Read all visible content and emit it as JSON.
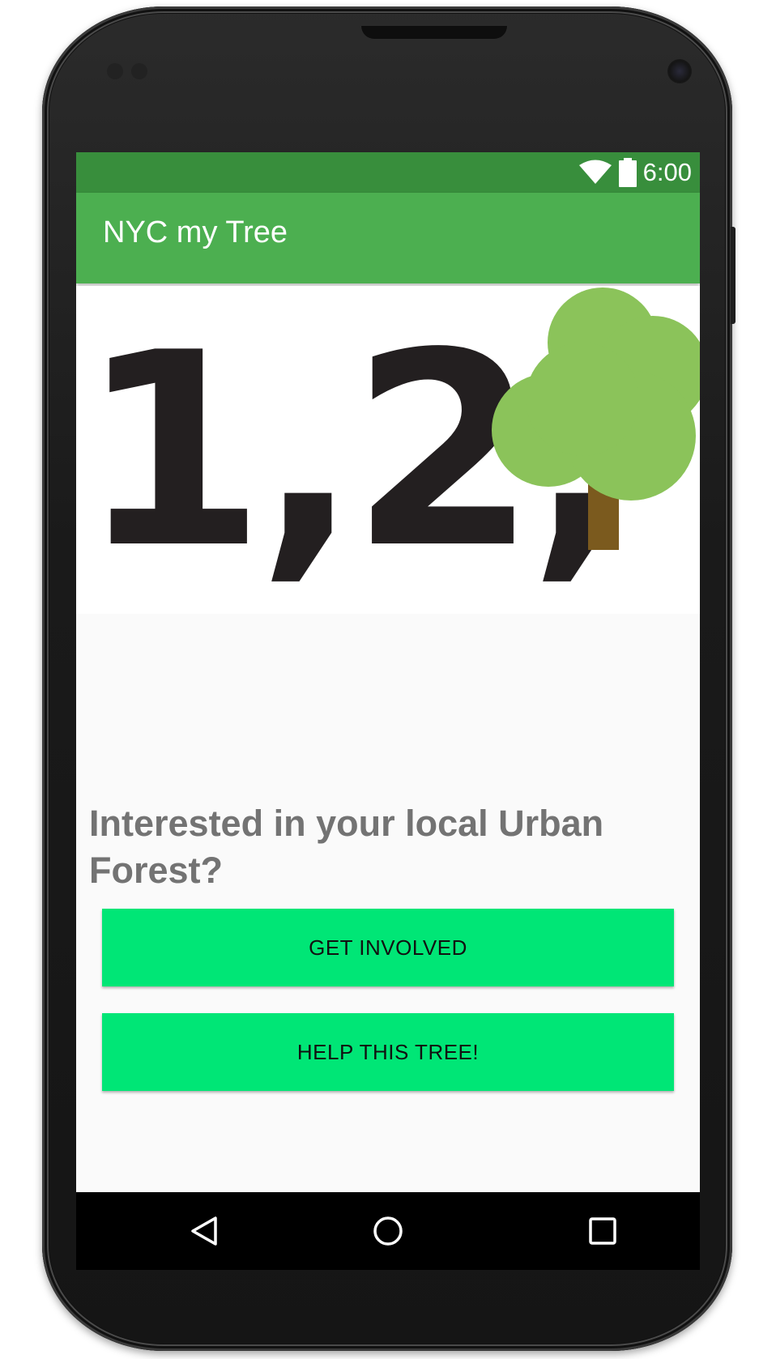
{
  "status_bar": {
    "time": "6:00",
    "icons": [
      "wifi-icon",
      "battery-icon"
    ]
  },
  "app_bar": {
    "title": "NYC my Tree"
  },
  "banner": {
    "text": "1,2,",
    "icon": "tree-icon",
    "colors": {
      "foliage": "#8bc35a",
      "trunk": "#7b5a1e",
      "digits": "#231f20"
    }
  },
  "main": {
    "headline": "Interested in your local Urban Forest?",
    "buttons": [
      {
        "label": "GET INVOLVED"
      },
      {
        "label": "HELP THIS TREE!"
      }
    ]
  },
  "nav_bar": {
    "icons": [
      "back-icon",
      "home-icon",
      "recents-icon"
    ]
  },
  "colors": {
    "status_bar": "#388e3c",
    "app_bar": "#4caf50",
    "button": "#00e676",
    "headline": "#737373"
  }
}
